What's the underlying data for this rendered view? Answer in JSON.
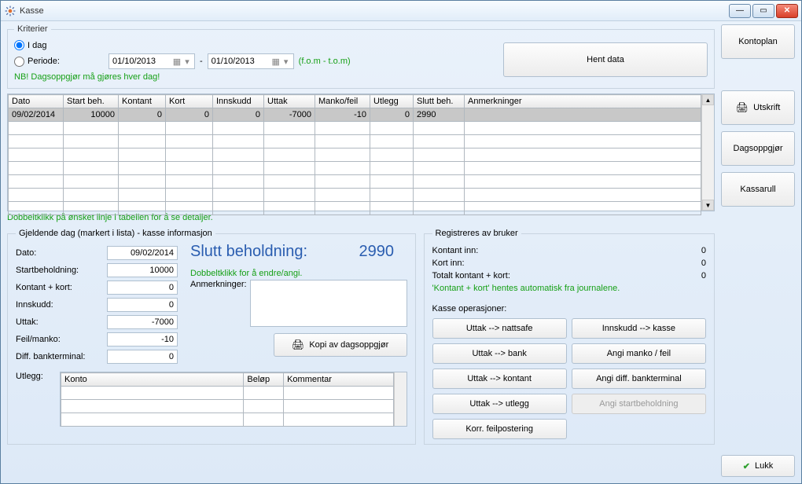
{
  "window": {
    "title": "Kasse"
  },
  "kriterier": {
    "legend": "Kriterier",
    "idag_label": "I dag",
    "periode_label": "Periode:",
    "date_from": "01/10/2013",
    "date_sep": "-",
    "date_to": "01/10/2013",
    "fom_tom": "(f.o.m - t.o.m)",
    "nb": "NB! Dagsoppgjør må gjøres hver dag!",
    "hent_data": "Hent data"
  },
  "sidebar": {
    "kontoplan": "Kontoplan",
    "utskrift": "Utskrift",
    "dagsoppgjor": "Dagsoppgjør",
    "kassarull": "Kassarull",
    "lukk": "Lukk"
  },
  "grid": {
    "headers": [
      "Dato",
      "Start beh.",
      "Kontant",
      "Kort",
      "Innskudd",
      "Uttak",
      "Manko/feil",
      "Utlegg",
      "Slutt beh.",
      "Anmerkninger"
    ],
    "rows": [
      {
        "dato": "09/02/2014",
        "start": "10000",
        "kontant": "0",
        "kort": "0",
        "innskudd": "0",
        "uttak": "-7000",
        "manko": "-10",
        "utlegg": "0",
        "slutt": "2990",
        "anm": ""
      }
    ],
    "hint": "Dobbeltklikk på ønsket linje i tabellen for å se detaljer."
  },
  "gjeldende": {
    "legend": "Gjeldende dag (markert i lista) - kasse informasjon",
    "dato_lab": "Dato:",
    "dato": "09/02/2014",
    "start_lab": "Startbeholdning:",
    "start": "10000",
    "kk_lab": "Kontant + kort:",
    "kk": "0",
    "innskudd_lab": "Innskudd:",
    "innskudd": "0",
    "uttak_lab": "Uttak:",
    "uttak": "-7000",
    "feil_lab": "Feil/manko:",
    "feil": "-10",
    "diff_lab": "Diff. bankterminal:",
    "diff": "0",
    "slutt_lab": "Slutt beholdning:",
    "slutt": "2990",
    "endre_hint": "Dobbeltklikk for å endre/angi.",
    "anm_lab": "Anmerkninger:",
    "kopi_btn": "Kopi av dagsoppgjør",
    "utlegg_lab": "Utlegg:",
    "utlegg_headers": [
      "Konto",
      "Beløp",
      "Kommentar"
    ]
  },
  "reg": {
    "legend": "Registreres av bruker",
    "kontant_lab": "Kontant inn:",
    "kontant": "0",
    "kort_lab": "Kort inn:",
    "kort": "0",
    "totalt_lab": "Totalt kontant + kort:",
    "totalt": "0",
    "auto_hint": "'Kontant + kort' hentes automatisk fra journalene.",
    "ops_lab": "Kasse operasjoner:",
    "ops": {
      "uttak_nattsafe": "Uttak --> nattsafe",
      "innskudd_kasse": "Innskudd --> kasse",
      "uttak_bank": "Uttak --> bank",
      "angi_manko": "Angi manko / feil",
      "uttak_kontant": "Uttak --> kontant",
      "angi_diff": "Angi diff. bankterminal",
      "uttak_utlegg": "Uttak --> utlegg",
      "angi_start": "Angi startbeholdning",
      "korr": "Korr. feilpostering"
    }
  }
}
